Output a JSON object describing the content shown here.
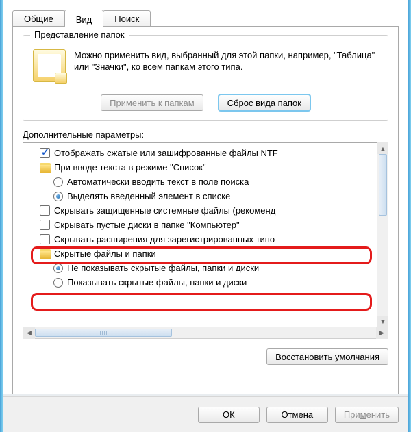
{
  "tabs": {
    "general": "Общие",
    "view": "Вид",
    "search": "Поиск"
  },
  "group": {
    "legend": "Представление папок",
    "text": "Можно применить вид, выбранный для этой папки, например, \"Таблица\" или \"Значки\", ко всем папкам этого типа.",
    "apply_btn_prefix": "Применить к пап",
    "apply_btn_u": "к",
    "apply_btn_suffix": "ам",
    "reset_btn_u": "С",
    "reset_btn_suffix": "брос вида папок"
  },
  "adv_label": "Дополнительные параметры:",
  "tree": {
    "ntfs_colors": {
      "label": "Отображать сжатые или зашифрованные файлы NTF"
    },
    "list_input": {
      "label": "При вводе текста в режиме \"Список\""
    },
    "auto_search": {
      "label": "Автоматически вводить текст в поле поиска"
    },
    "select_typed": {
      "label": "Выделять введенный элемент в списке"
    },
    "hide_protected": {
      "label": "Скрывать защищенные системные файлы (рекоменд"
    },
    "hide_empty": {
      "label": "Скрывать пустые диски в папке \"Компьютер\""
    },
    "hide_ext": {
      "label": "Скрывать расширения для зарегистрированных типо"
    },
    "hidden_group": {
      "label": "Скрытые файлы и папки"
    },
    "dont_show": {
      "label": "Не показывать скрытые файлы, папки и диски"
    },
    "show_hidden": {
      "label": "Показывать скрытые файлы, папки и диски"
    }
  },
  "restore_btn_u": "В",
  "restore_btn_suffix": "осстановить умолчания",
  "buttons": {
    "ok": "ОК",
    "cancel": "Отмена",
    "apply_prefix": "При",
    "apply_u": "м",
    "apply_suffix": "енить"
  }
}
